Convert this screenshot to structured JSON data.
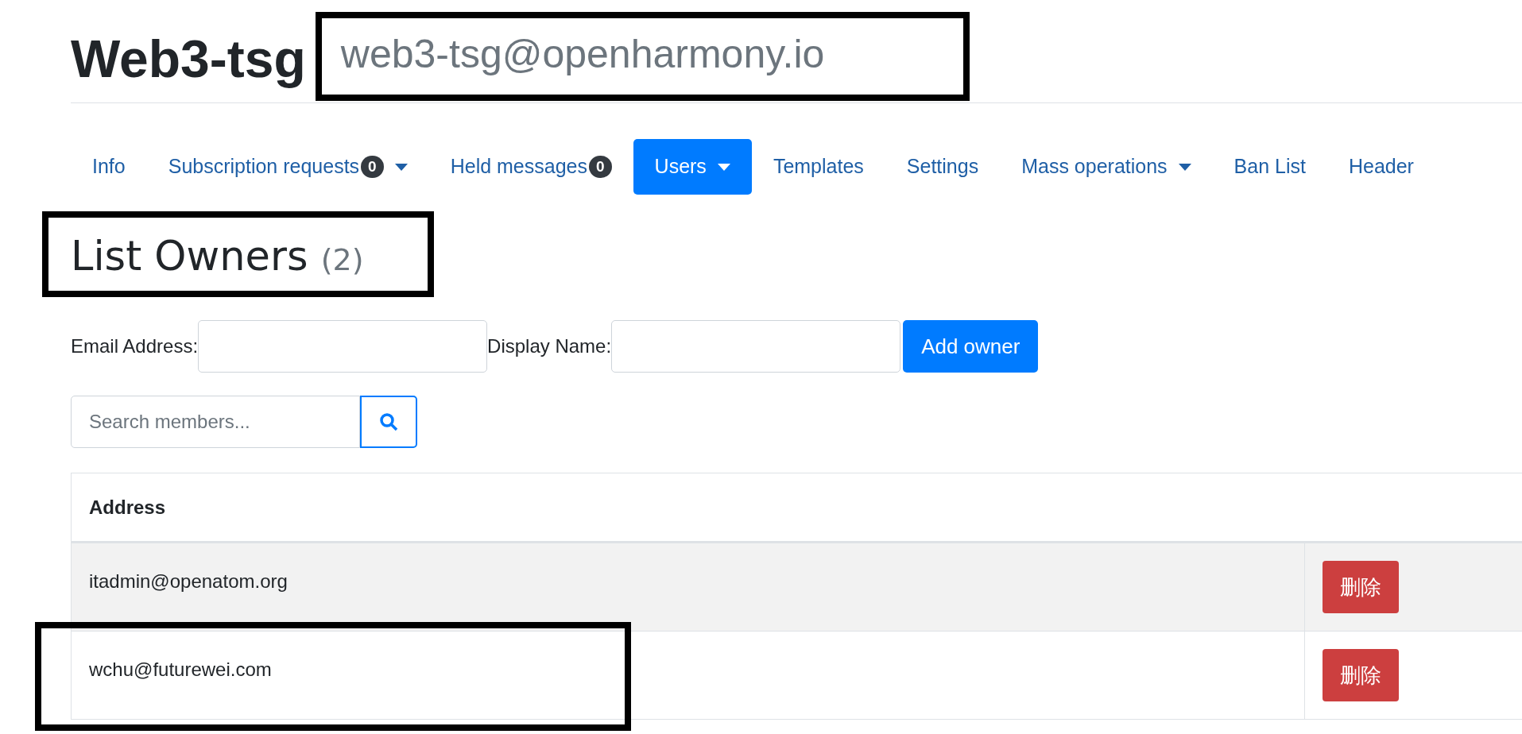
{
  "header": {
    "title": "Web3-tsg",
    "list_address": "web3-tsg@openharmony.io"
  },
  "tabs": [
    {
      "label": "Info",
      "selected": false
    },
    {
      "label": "Subscription requests",
      "badge": "0",
      "dropdown": true,
      "selected": false
    },
    {
      "label": "Held messages",
      "badge": "0",
      "dropdown": false,
      "selected": false
    },
    {
      "label": "Users",
      "dropdown": true,
      "selected": true
    },
    {
      "label": "Templates",
      "selected": false
    },
    {
      "label": "Settings",
      "selected": false
    },
    {
      "label": "Mass operations",
      "dropdown": true,
      "selected": false
    },
    {
      "label": "Ban List",
      "selected": false
    },
    {
      "label": "Header",
      "selected": false
    }
  ],
  "section": {
    "heading": "List Owners",
    "count": "(2)"
  },
  "add_form": {
    "email_label": "Email Address:",
    "name_label": "Display Name:",
    "button": "Add owner"
  },
  "search": {
    "placeholder": "Search members..."
  },
  "table": {
    "columns": [
      "Address"
    ],
    "rows": [
      {
        "address": "itadmin@openatom.org",
        "action": "删除",
        "striped": true
      },
      {
        "address": "wchu@futurewei.com",
        "action": "删除",
        "striped": false
      }
    ]
  }
}
